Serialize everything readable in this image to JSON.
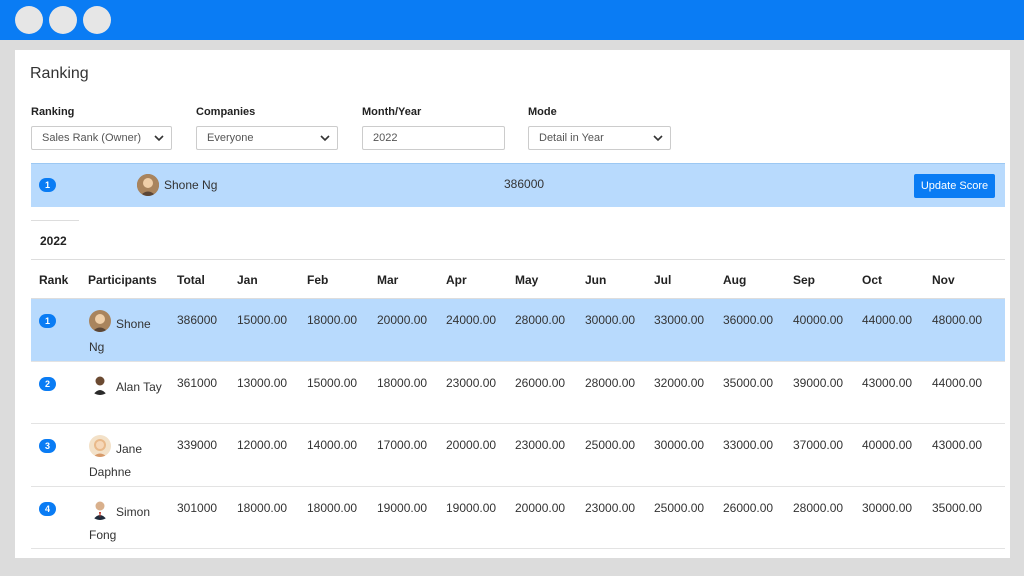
{
  "window": {
    "controls": [
      "close",
      "minimize",
      "maximize"
    ]
  },
  "page": {
    "title": "Ranking"
  },
  "filters": [
    {
      "label": "Ranking",
      "value": "Sales Rank (Owner)",
      "type": "select"
    },
    {
      "label": "Companies",
      "value": "Everyone",
      "type": "select"
    },
    {
      "label": "Month/Year",
      "value": "2022",
      "type": "input"
    },
    {
      "label": "Mode",
      "value": "Detail in Year",
      "type": "select"
    }
  ],
  "top": {
    "rank": "1",
    "name": "Shone Ng",
    "score": "386000",
    "button": "Update Score"
  },
  "year_tab": "2022",
  "table": {
    "headers": [
      "Rank",
      "Participants",
      "Total",
      "Jan",
      "Feb",
      "Mar",
      "Apr",
      "May",
      "Jun",
      "Jul",
      "Aug",
      "Sep",
      "Oct",
      "Nov"
    ],
    "rows": [
      {
        "rank": "1",
        "name": "Shone Ng",
        "total": "386000",
        "months": [
          "15000.00",
          "18000.00",
          "20000.00",
          "24000.00",
          "28000.00",
          "30000.00",
          "33000.00",
          "36000.00",
          "40000.00",
          "44000.00",
          "48000.00"
        ]
      },
      {
        "rank": "2",
        "name": "Alan Tay",
        "total": "361000",
        "months": [
          "13000.00",
          "15000.00",
          "18000.00",
          "23000.00",
          "26000.00",
          "28000.00",
          "32000.00",
          "35000.00",
          "39000.00",
          "43000.00",
          "44000.00"
        ]
      },
      {
        "rank": "3",
        "name": "Jane Daphne",
        "total": "339000",
        "months": [
          "12000.00",
          "14000.00",
          "17000.00",
          "20000.00",
          "23000.00",
          "25000.00",
          "30000.00",
          "33000.00",
          "37000.00",
          "40000.00",
          "43000.00"
        ]
      },
      {
        "rank": "4",
        "name": "Simon Fong",
        "total": "301000",
        "months": [
          "18000.00",
          "18000.00",
          "19000.00",
          "19000.00",
          "20000.00",
          "23000.00",
          "25000.00",
          "26000.00",
          "28000.00",
          "30000.00",
          "35000.00"
        ]
      }
    ]
  },
  "colors": {
    "accent": "#0a7cf4",
    "highlight": "#b8dafd"
  }
}
